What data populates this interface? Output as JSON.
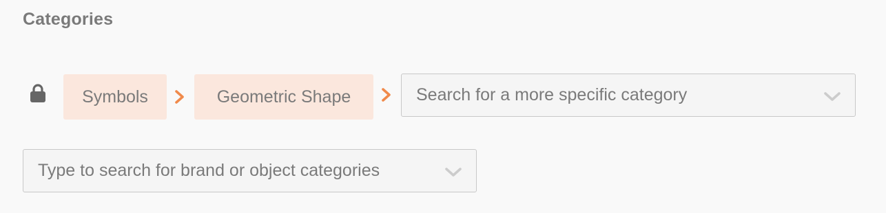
{
  "section": {
    "title": "Categories"
  },
  "breadcrumb": {
    "lock_icon": "lock-icon",
    "separator_icon": "chevron-right-icon",
    "items": [
      {
        "label": "Symbols"
      },
      {
        "label": "Geometric Shape"
      }
    ]
  },
  "specific_category_select": {
    "placeholder": "Search for a more specific category",
    "icon": "chevron-down-icon"
  },
  "brand_object_select": {
    "placeholder": "Type to search for brand or object categories",
    "icon": "chevron-down-icon"
  },
  "colors": {
    "accent": "#f08a4b",
    "crumb_background": "#fbe7dd",
    "text": "#7a7a7a",
    "background": "#f9f9f9"
  }
}
